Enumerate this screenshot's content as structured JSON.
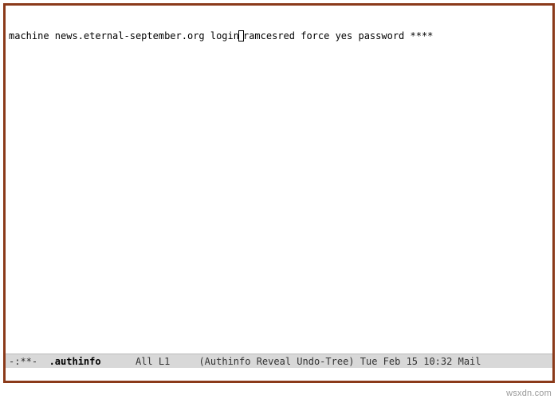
{
  "buffer": {
    "line1_part1": "machine news.eternal-september.org login",
    "line1_part2": "ramcesred force yes password ****"
  },
  "modeline": {
    "status": "-:**-",
    "buffer_name": ".authinfo",
    "position": "All L1",
    "modes": "(Authinfo Reveal Undo-Tree)",
    "datetime": "Tue Feb 15 10:32",
    "mail": "Mail"
  },
  "watermark": "wsxdn.com"
}
